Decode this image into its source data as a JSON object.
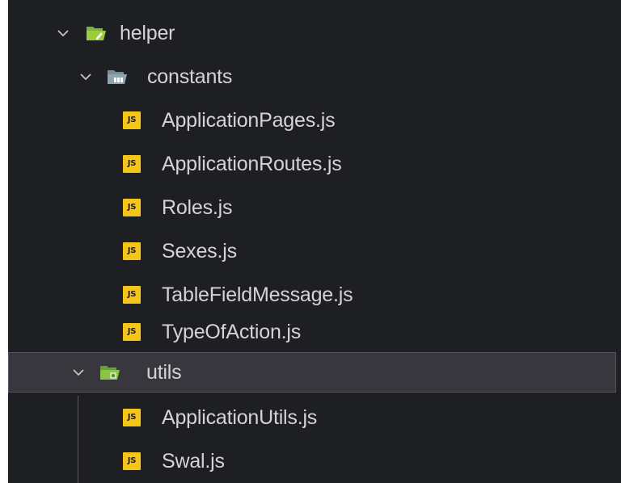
{
  "tree": {
    "helper": {
      "label": "helper",
      "icon": "folder-open-helper-icon",
      "expanded": true,
      "color": "#9ccc3c"
    },
    "constants": {
      "label": "constants",
      "icon": "folder-open-constants-icon",
      "expanded": true,
      "color": "#90a4ae",
      "files": [
        {
          "label": "ApplicationPages.js",
          "icon": "js-file-icon",
          "badge": "JS"
        },
        {
          "label": "ApplicationRoutes.js",
          "icon": "js-file-icon",
          "badge": "JS"
        },
        {
          "label": "Roles.js",
          "icon": "js-file-icon",
          "badge": "JS"
        },
        {
          "label": "Sexes.js",
          "icon": "js-file-icon",
          "badge": "JS"
        },
        {
          "label": "TableFieldMessage.js",
          "icon": "js-file-icon",
          "badge": "JS"
        },
        {
          "label": "TypeOfAction.js",
          "icon": "js-file-icon",
          "badge": "JS"
        }
      ]
    },
    "utils": {
      "label": "utils",
      "icon": "folder-open-utils-icon",
      "expanded": true,
      "selected": true,
      "color": "#8bc34a",
      "files": [
        {
          "label": "ApplicationUtils.js",
          "icon": "js-file-icon",
          "badge": "JS"
        },
        {
          "label": "Swal.js",
          "icon": "js-file-icon",
          "badge": "JS"
        }
      ]
    }
  },
  "colors": {
    "background": "#1e1f22",
    "selection": "#37373d",
    "selection_border": "#4e5370",
    "text": "#d4d4d4",
    "js_badge": "#f5c518"
  }
}
